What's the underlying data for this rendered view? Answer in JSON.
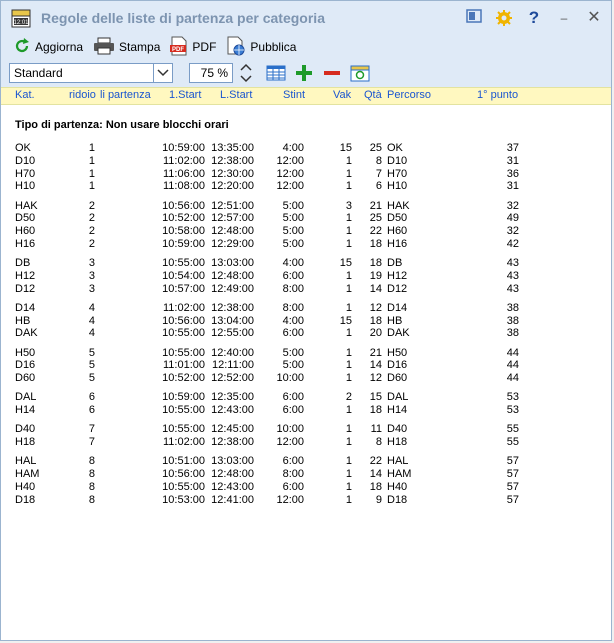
{
  "window": {
    "title": "Regole delle liste di partenza per categoria"
  },
  "toolbar": {
    "refresh_label": "Aggiorna",
    "print_label": "Stampa",
    "pdf_label": "PDF",
    "publish_label": "Pubblica"
  },
  "controls": {
    "view_value": "Standard",
    "zoom_value": "75 %"
  },
  "columns": [
    "Kat.",
    "ridoio",
    "li partenza",
    "1.Start",
    "L.Start",
    "Stint",
    "Vak",
    "Qtà",
    "Percorso",
    "1° punto"
  ],
  "section_title": "Tipo di partenza: Non usare blocchi orari",
  "groups": [
    [
      [
        "OK",
        "1",
        "",
        "10:59:00",
        "13:35:00",
        "4:00",
        "15",
        "25",
        "OK",
        "37"
      ],
      [
        "D10",
        "1",
        "",
        "11:02:00",
        "12:38:00",
        "12:00",
        "1",
        "8",
        "D10",
        "31"
      ],
      [
        "H70",
        "1",
        "",
        "11:06:00",
        "12:30:00",
        "12:00",
        "1",
        "7",
        "H70",
        "36"
      ],
      [
        "H10",
        "1",
        "",
        "11:08:00",
        "12:20:00",
        "12:00",
        "1",
        "6",
        "H10",
        "31"
      ]
    ],
    [
      [
        "HAK",
        "2",
        "",
        "10:56:00",
        "12:51:00",
        "5:00",
        "3",
        "21",
        "HAK",
        "32"
      ],
      [
        "D50",
        "2",
        "",
        "10:52:00",
        "12:57:00",
        "5:00",
        "1",
        "25",
        "D50",
        "49"
      ],
      [
        "H60",
        "2",
        "",
        "10:58:00",
        "12:48:00",
        "5:00",
        "1",
        "22",
        "H60",
        "32"
      ],
      [
        "H16",
        "2",
        "",
        "10:59:00",
        "12:29:00",
        "5:00",
        "1",
        "18",
        "H16",
        "42"
      ]
    ],
    [
      [
        "DB",
        "3",
        "",
        "10:55:00",
        "13:03:00",
        "4:00",
        "15",
        "18",
        "DB",
        "43"
      ],
      [
        "H12",
        "3",
        "",
        "10:54:00",
        "12:48:00",
        "6:00",
        "1",
        "19",
        "H12",
        "43"
      ],
      [
        "D12",
        "3",
        "",
        "10:57:00",
        "12:49:00",
        "8:00",
        "1",
        "14",
        "D12",
        "43"
      ]
    ],
    [
      [
        "D14",
        "4",
        "",
        "11:02:00",
        "12:38:00",
        "8:00",
        "1",
        "12",
        "D14",
        "38"
      ],
      [
        "HB",
        "4",
        "",
        "10:56:00",
        "13:04:00",
        "4:00",
        "15",
        "18",
        "HB",
        "38"
      ],
      [
        "DAK",
        "4",
        "",
        "10:55:00",
        "12:55:00",
        "6:00",
        "1",
        "20",
        "DAK",
        "38"
      ]
    ],
    [
      [
        "H50",
        "5",
        "",
        "10:55:00",
        "12:40:00",
        "5:00",
        "1",
        "21",
        "H50",
        "44"
      ],
      [
        "D16",
        "5",
        "",
        "11:01:00",
        "12:11:00",
        "5:00",
        "1",
        "14",
        "D16",
        "44"
      ],
      [
        "D60",
        "5",
        "",
        "10:52:00",
        "12:52:00",
        "10:00",
        "1",
        "12",
        "D60",
        "44"
      ]
    ],
    [
      [
        "DAL",
        "6",
        "",
        "10:59:00",
        "12:35:00",
        "6:00",
        "2",
        "15",
        "DAL",
        "53"
      ],
      [
        "H14",
        "6",
        "",
        "10:55:00",
        "12:43:00",
        "6:00",
        "1",
        "18",
        "H14",
        "53"
      ]
    ],
    [
      [
        "D40",
        "7",
        "",
        "10:55:00",
        "12:45:00",
        "10:00",
        "1",
        "11",
        "D40",
        "55"
      ],
      [
        "H18",
        "7",
        "",
        "11:02:00",
        "12:38:00",
        "12:00",
        "1",
        "8",
        "H18",
        "55"
      ]
    ],
    [
      [
        "HAL",
        "8",
        "",
        "10:51:00",
        "13:03:00",
        "6:00",
        "1",
        "22",
        "HAL",
        "57"
      ],
      [
        "HAM",
        "8",
        "",
        "10:56:00",
        "12:48:00",
        "8:00",
        "1",
        "14",
        "HAM",
        "57"
      ],
      [
        "H40",
        "8",
        "",
        "10:55:00",
        "12:43:00",
        "6:00",
        "1",
        "18",
        "H40",
        "57"
      ],
      [
        "D18",
        "8",
        "",
        "10:53:00",
        "12:41:00",
        "12:00",
        "1",
        "9",
        "D18",
        "57"
      ]
    ]
  ]
}
